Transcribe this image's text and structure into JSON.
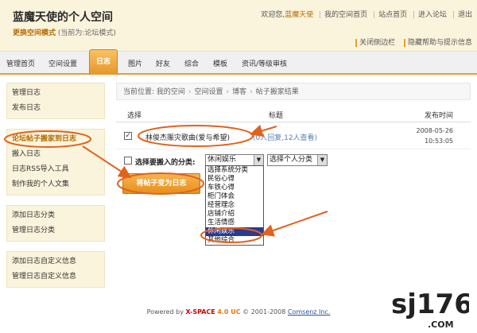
{
  "header": {
    "site_title": "蓝魔天使的个人空间",
    "mode_link": "更换空间模式",
    "mode_note": "(当前为:论坛模式)",
    "welcome": "欢迎您,",
    "username": "蓝魔天使",
    "links": [
      "我的空间首页",
      "站点首页",
      "进入论坛",
      "退出"
    ],
    "sub_links": [
      "关闭侧边栏",
      "隐藏帮助与提示信息"
    ]
  },
  "nav": {
    "items": [
      "管理首页",
      "空间设置",
      "日志",
      "图片",
      "好友",
      "综合",
      "模板",
      "资讯/等级审核"
    ]
  },
  "sidebar": {
    "groups": [
      [
        "管理日志",
        "发布日志"
      ],
      [
        "论坛帖子搬家到日志",
        "搬入日志",
        "日志RSS导入工具",
        "制作我的个人文集"
      ],
      [
        "添加日志分类",
        "管理日志分类"
      ],
      [
        "添加日志自定义信息",
        "管理日志自定义信息"
      ]
    ]
  },
  "breadcrumb": [
    "当前位置: 我的空间",
    "空间设置",
    "博客",
    "帖子搬家结果"
  ],
  "table": {
    "col_select": "选择",
    "col_title": "标题",
    "col_time": "发布时间",
    "rows": [
      {
        "title": "林俊杰赈灾歌曲(爱与希望)",
        "stats": "(0人回复,12人查看)",
        "date": "2008-05-26",
        "time": "10:53:05"
      }
    ]
  },
  "import": {
    "label": "选择要搬入的分类:",
    "system_select": "休闲娱乐",
    "personal_select": "选择个人分类",
    "options": [
      "选择系统分类",
      "民俗心得",
      "车铁心得",
      "柜门体会",
      "经营理念",
      "店铺介绍",
      "生活情感",
      "休闲娱乐",
      "其他综合"
    ],
    "selected_option": "休闲娱乐",
    "button": "将帖子变为日志"
  },
  "footer": {
    "prefix": "Powered by",
    "brand": "X-SPACE",
    "version": "4.0 UC",
    "copyright": "© 2001-2008",
    "company": "Comsenz Inc."
  },
  "watermark": {
    "main": "sj176",
    "sub": ".COM"
  },
  "colors": {
    "accent": "#e8972a",
    "annotation": "#e0621e",
    "header_bg": "#fbf4dc"
  }
}
